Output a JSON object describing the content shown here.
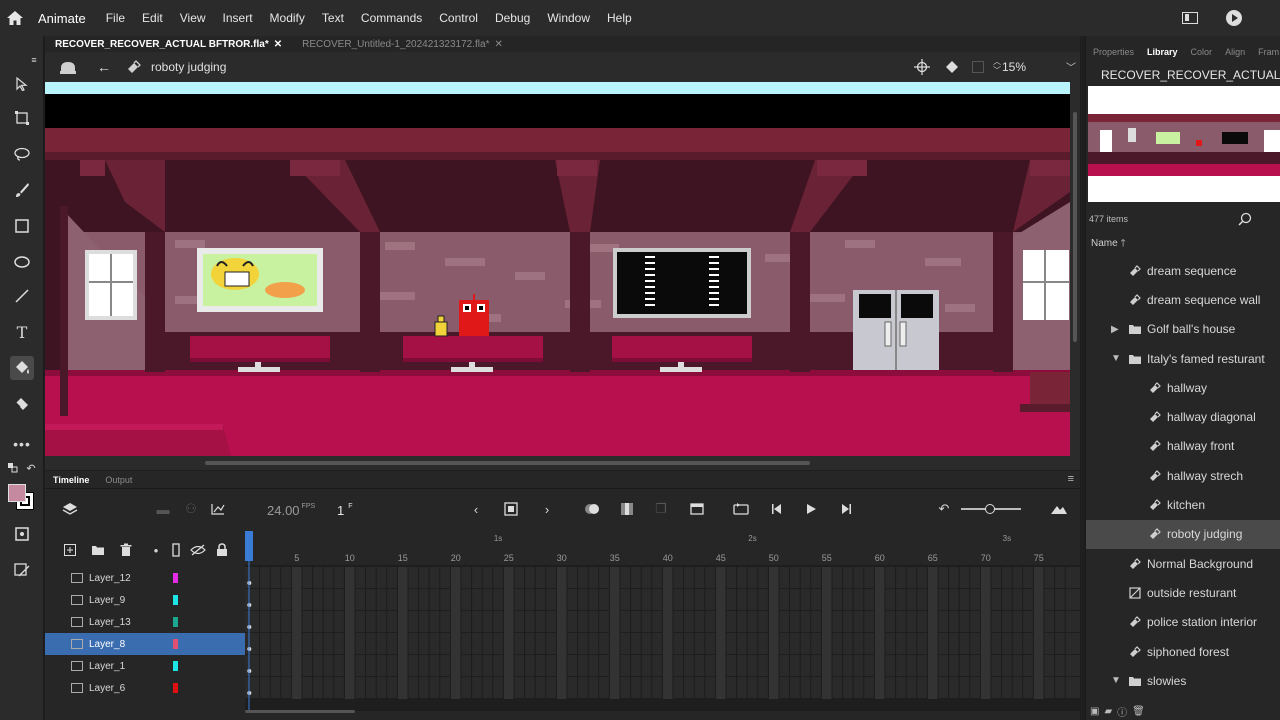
{
  "app": {
    "name": "Animate"
  },
  "menu": [
    "File",
    "Edit",
    "View",
    "Insert",
    "Modify",
    "Text",
    "Commands",
    "Control",
    "Debug",
    "Window",
    "Help"
  ],
  "doc_tabs": [
    {
      "label": "RECOVER_RECOVER_ACTUAL BFTROR.fla*"
    },
    {
      "label": "RECOVER_Untitled-1_202421323172.fla*"
    }
  ],
  "editbar": {
    "scene_name": "roboty judging",
    "zoom": "15%"
  },
  "timeline": {
    "tabs": [
      "Timeline",
      "Output"
    ],
    "fps_value": "24.00",
    "fps_unit": "FPS",
    "current_frame": "1",
    "current_frame_unit": "F",
    "frame_numbers": [
      "5",
      "10",
      "15",
      "20",
      "25",
      "30",
      "35",
      "40",
      "45",
      "50",
      "55",
      "60",
      "65",
      "70",
      "75"
    ],
    "second_markers": [
      "1s",
      "2s",
      "3s"
    ],
    "layers": [
      {
        "name": "Layer_12",
        "color": "#e62be6"
      },
      {
        "name": "Layer_9",
        "color": "#1ee6e6"
      },
      {
        "name": "Layer_13",
        "color": "#1aa890"
      },
      {
        "name": "Layer_8",
        "color": "#e05070",
        "selected": true
      },
      {
        "name": "Layer_1",
        "color": "#1ee6e6"
      },
      {
        "name": "Layer_6",
        "color": "#e01010"
      }
    ]
  },
  "right_panel": {
    "tabs": [
      "Properties",
      "Library",
      "Color",
      "Align",
      "Fram"
    ],
    "library_title": "RECOVER_RECOVER_ACTUAL ...",
    "items_count": "477 items",
    "name_column": "Name",
    "items": [
      {
        "label": "dream sequence",
        "type": "symbol",
        "indent": 1
      },
      {
        "label": "dream sequence wall",
        "type": "symbol",
        "indent": 1
      },
      {
        "label": "Golf ball's house",
        "type": "folder",
        "indent": 1,
        "arrow": "right"
      },
      {
        "label": "Italy's famed resturant",
        "type": "folder",
        "indent": 1,
        "arrow": "down"
      },
      {
        "label": "hallway",
        "type": "symbol",
        "indent": 2
      },
      {
        "label": "hallway diagonal",
        "type": "symbol",
        "indent": 2
      },
      {
        "label": "hallway front",
        "type": "symbol",
        "indent": 2
      },
      {
        "label": "hallway strech",
        "type": "symbol",
        "indent": 2
      },
      {
        "label": "kitchen",
        "type": "symbol",
        "indent": 2
      },
      {
        "label": "roboty judging",
        "type": "symbol",
        "indent": 2,
        "selected": true
      },
      {
        "label": "Normal Background",
        "type": "symbol",
        "indent": 1
      },
      {
        "label": "outside resturant",
        "type": "symbol",
        "indent": 1
      },
      {
        "label": "police station interior",
        "type": "symbol",
        "indent": 1
      },
      {
        "label": "siphoned forest",
        "type": "symbol",
        "indent": 1
      },
      {
        "label": "slowies",
        "type": "folder",
        "indent": 1,
        "arrow": "down"
      }
    ]
  },
  "colors": {
    "accent": "#3a6cb0",
    "stage_sky": "#b9f3fb",
    "wall_dark": "#5a1c2d",
    "floor": "#b8104f",
    "table": "#a51045"
  }
}
